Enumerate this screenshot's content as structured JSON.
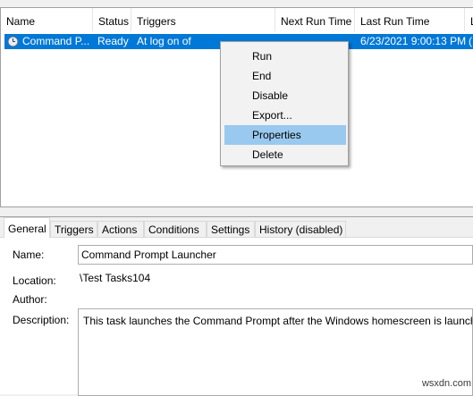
{
  "columns": [
    {
      "label": "Name"
    },
    {
      "label": "Status"
    },
    {
      "label": "Triggers"
    },
    {
      "label": "Next Run Time"
    },
    {
      "label": "Last Run Time"
    },
    {
      "label": "L"
    }
  ],
  "task": {
    "name": "Command P...",
    "status": "Ready",
    "trigger": "At log on of ",
    "last_run": "6/23/2021 9:00:13 PM",
    "last_result_partial": "("
  },
  "context_menu": {
    "items": [
      "Run",
      "End",
      "Disable",
      "Export...",
      "Properties",
      "Delete"
    ],
    "highlighted": "Properties"
  },
  "tabs": [
    "General",
    "Triggers",
    "Actions",
    "Conditions",
    "Settings",
    "History (disabled)"
  ],
  "active_tab": "General",
  "general": {
    "name_label": "Name:",
    "name_value": "Command Prompt Launcher",
    "location_label": "Location:",
    "location_value": "\\Test Tasks104",
    "author_label": "Author:",
    "description_label": "Description:",
    "description_value": "This task launches the Command Prompt after the Windows homescreen is launch"
  },
  "watermark": "wsxdn.com",
  "colors": {
    "selection": "#0078d7",
    "menu_highlight": "#99c9ef"
  }
}
